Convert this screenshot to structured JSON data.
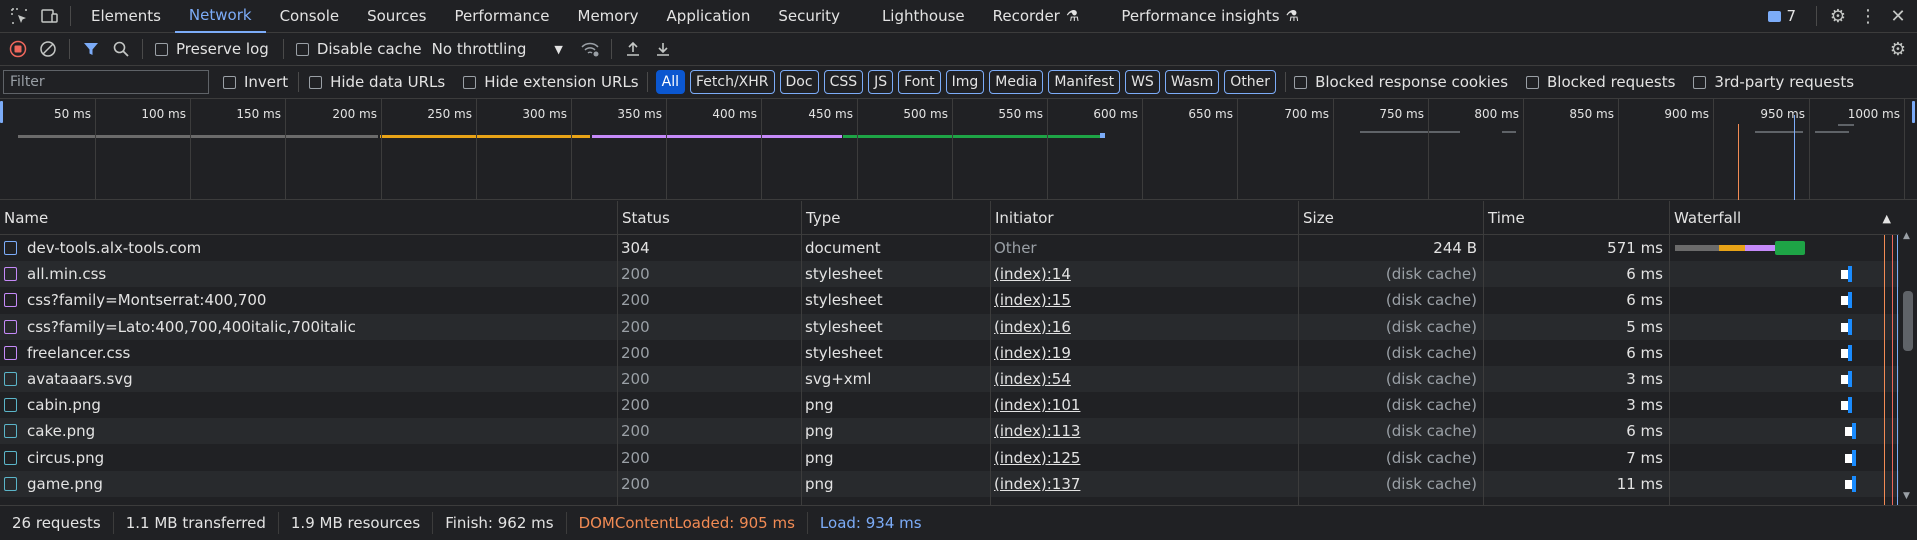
{
  "tabs": [
    "Elements",
    "Network",
    "Console",
    "Sources",
    "Performance",
    "Memory",
    "Application",
    "Security",
    "Lighthouse",
    "Recorder",
    "Performance insights"
  ],
  "active_tab": "Network",
  "issues_count": "7",
  "toolbar": {
    "preserve_log": "Preserve log",
    "disable_cache": "Disable cache",
    "throttling": "No throttling"
  },
  "filter": {
    "placeholder": "Filter",
    "invert": "Invert",
    "hide_data_urls": "Hide data URLs",
    "hide_extension_urls": "Hide extension URLs",
    "types": [
      "All",
      "Fetch/XHR",
      "Doc",
      "CSS",
      "JS",
      "Font",
      "Img",
      "Media",
      "Manifest",
      "WS",
      "Wasm",
      "Other"
    ],
    "blocked_cookies": "Blocked response cookies",
    "blocked_requests": "Blocked requests",
    "third_party": "3rd-party requests"
  },
  "timeline_ticks": [
    "50 ms",
    "100 ms",
    "150 ms",
    "200 ms",
    "250 ms",
    "300 ms",
    "350 ms",
    "400 ms",
    "450 ms",
    "500 ms",
    "550 ms",
    "600 ms",
    "650 ms",
    "700 ms",
    "750 ms",
    "800 ms",
    "850 ms",
    "900 ms",
    "950 ms",
    "1000 ms"
  ],
  "columns": {
    "name": "Name",
    "status": "Status",
    "type": "Type",
    "initiator": "Initiator",
    "size": "Size",
    "time": "Time",
    "waterfall": "Waterfall"
  },
  "rows": [
    {
      "name": "dev-tools.alx-tools.com",
      "status": "304",
      "type": "document",
      "initiator": "Other",
      "size": "244 B",
      "time": "571 ms",
      "icon": "document-icon"
    },
    {
      "name": "all.min.css",
      "status": "200",
      "type": "stylesheet",
      "initiator": "(index):14",
      "size": "(disk cache)",
      "time": "6 ms",
      "icon": "stylesheet-icon"
    },
    {
      "name": "css?family=Montserrat:400,700",
      "status": "200",
      "type": "stylesheet",
      "initiator": "(index):15",
      "size": "(disk cache)",
      "time": "6 ms",
      "icon": "stylesheet-icon"
    },
    {
      "name": "css?family=Lato:400,700,400italic,700italic",
      "status": "200",
      "type": "stylesheet",
      "initiator": "(index):16",
      "size": "(disk cache)",
      "time": "5 ms",
      "icon": "stylesheet-icon"
    },
    {
      "name": "freelancer.css",
      "status": "200",
      "type": "stylesheet",
      "initiator": "(index):19",
      "size": "(disk cache)",
      "time": "6 ms",
      "icon": "stylesheet-icon"
    },
    {
      "name": "avataaars.svg",
      "status": "200",
      "type": "svg+xml",
      "initiator": "(index):54",
      "size": "(disk cache)",
      "time": "3 ms",
      "icon": "image-icon"
    },
    {
      "name": "cabin.png",
      "status": "200",
      "type": "png",
      "initiator": "(index):101",
      "size": "(disk cache)",
      "time": "3 ms",
      "icon": "image-icon"
    },
    {
      "name": "cake.png",
      "status": "200",
      "type": "png",
      "initiator": "(index):113",
      "size": "(disk cache)",
      "time": "6 ms",
      "icon": "image-icon"
    },
    {
      "name": "circus.png",
      "status": "200",
      "type": "png",
      "initiator": "(index):125",
      "size": "(disk cache)",
      "time": "7 ms",
      "icon": "image-icon"
    },
    {
      "name": "game.png",
      "status": "200",
      "type": "png",
      "initiator": "(index):137",
      "size": "(disk cache)",
      "time": "11 ms",
      "icon": "image-icon"
    }
  ],
  "statusbar": {
    "requests": "26 requests",
    "transferred": "1.1 MB transferred",
    "resources": "1.9 MB resources",
    "finish": "Finish: 962 ms",
    "dcl": "DOMContentLoaded: 905 ms",
    "load": "Load: 934 ms"
  },
  "colors": {
    "accent": "#7cacf8",
    "dcl": "#f28b54",
    "load": "#7cacf8"
  }
}
